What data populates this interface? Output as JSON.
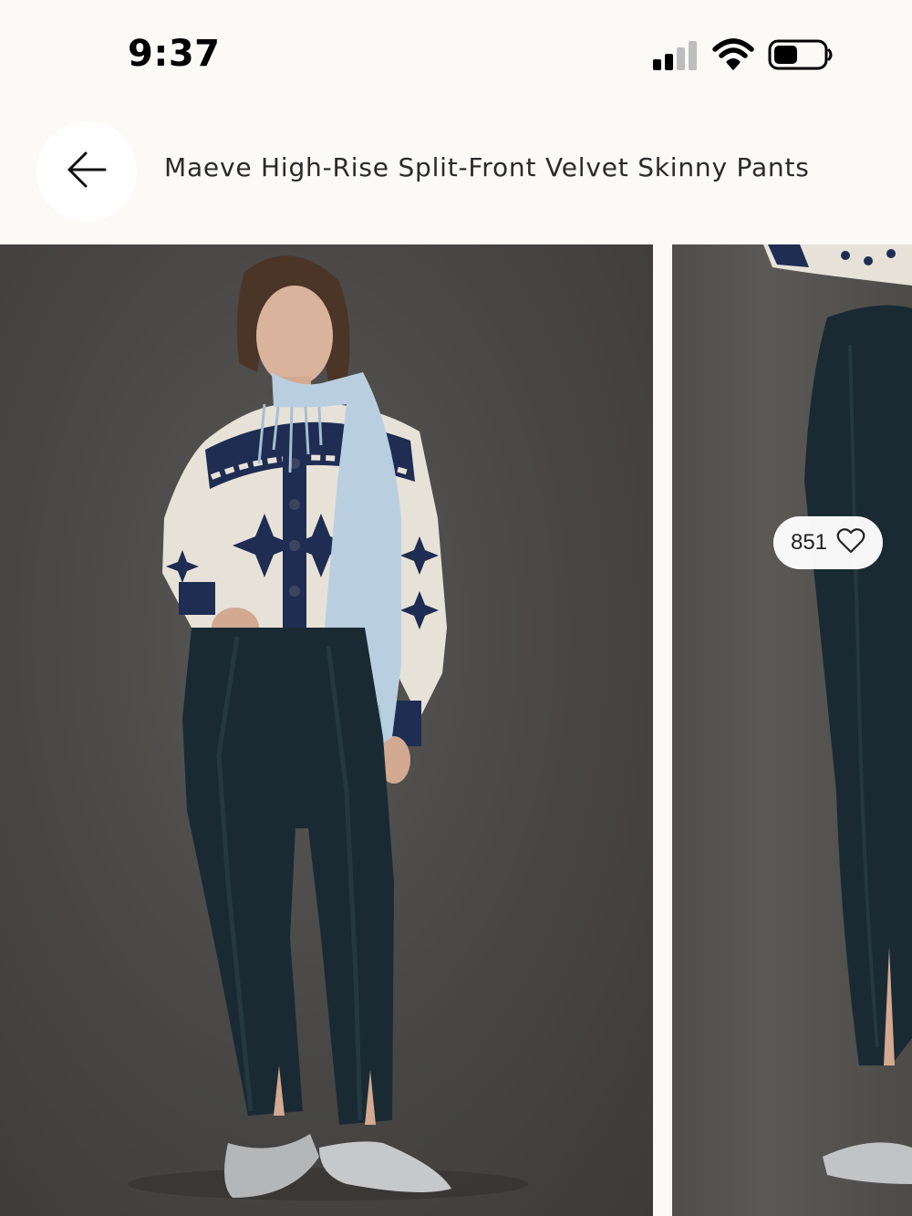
{
  "status_bar": {
    "time": "9:37",
    "signal_icon": "cellular-signal-icon",
    "wifi_icon": "wifi-icon",
    "battery_icon": "battery-icon",
    "battery_level": 0.45
  },
  "header": {
    "back_icon": "arrow-left-icon",
    "title": "Maeve High-Rise Split-Front Velvet Skinny Pants"
  },
  "gallery": {
    "images": [
      {
        "semantic": "product-photo-full-outfit"
      },
      {
        "semantic": "product-photo-side-view"
      }
    ],
    "like_count": "851",
    "like_icon": "heart-outline-icon"
  },
  "colors": {
    "page_background": "#fbfaf7",
    "photo_background": "#4a4947",
    "velvet_pants": "#1a2a33",
    "sweater_navy": "#1f2d52",
    "scarf": "#b9cfe0"
  }
}
